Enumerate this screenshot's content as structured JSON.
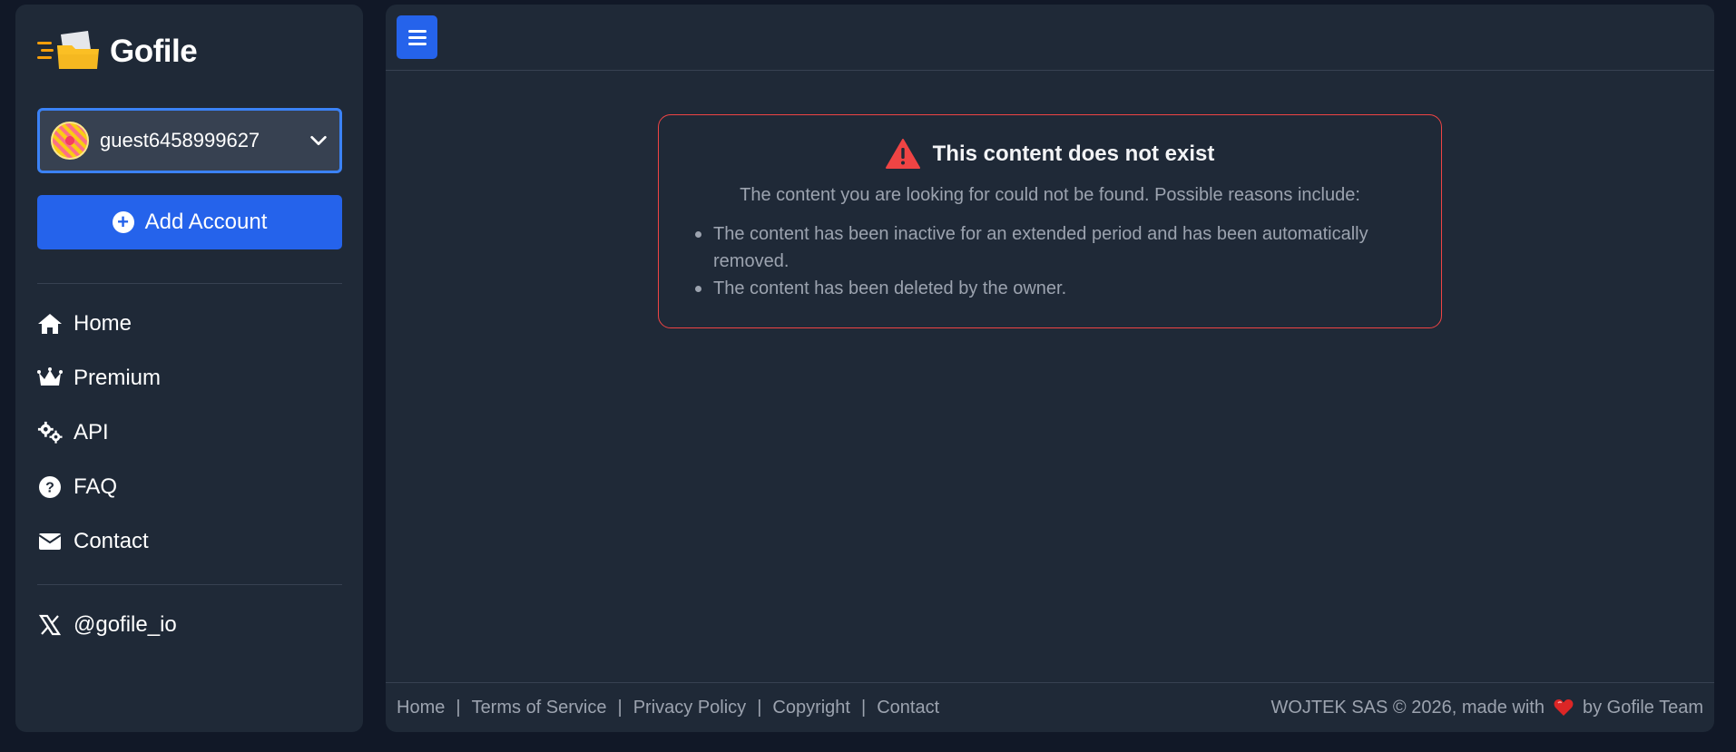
{
  "app": {
    "name": "Gofile"
  },
  "account": {
    "username": "guest6458999627"
  },
  "add_account_label": "Add Account",
  "nav": [
    {
      "label": "Home",
      "icon": "home-icon"
    },
    {
      "label": "Premium",
      "icon": "crown-icon"
    },
    {
      "label": "API",
      "icon": "gears-icon"
    },
    {
      "label": "FAQ",
      "icon": "question-circle-icon"
    },
    {
      "label": "Contact",
      "icon": "envelope-icon"
    }
  ],
  "social": {
    "label": "@gofile_io",
    "icon": "x-twitter-icon"
  },
  "error": {
    "title": "This content does not exist",
    "description": "The content you are looking for could not be found. Possible reasons include:",
    "reasons": [
      "The content has been inactive for an extended period and has been automatically removed.",
      "The content has been deleted by the owner."
    ]
  },
  "footer": {
    "links": [
      "Home",
      "Terms of Service",
      "Privacy Policy",
      "Copyright",
      "Contact"
    ],
    "separator": "|",
    "copyright_prefix": "WOJTEK SAS © 2026, made with",
    "copyright_suffix": "by Gofile Team"
  },
  "colors": {
    "page_bg": "#111827",
    "panel_bg": "#1f2937",
    "accent": "#2563eb",
    "error_border": "#ef4444",
    "muted_text": "#9ca3af"
  }
}
